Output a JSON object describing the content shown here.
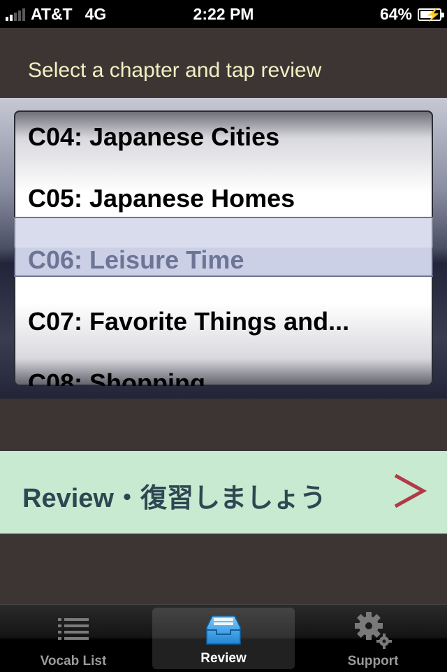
{
  "status_bar": {
    "carrier": "AT&T",
    "network": "4G",
    "time": "2:22 PM",
    "battery_percent": "64%",
    "battery_level": 0.64
  },
  "header": {
    "prompt": "Select a chapter and tap review"
  },
  "picker": {
    "items": [
      "C04: Japanese Cities",
      "C05: Japanese Homes",
      "C06: Leisure Time",
      "C07: Favorite Things and...",
      "C08: Shopping"
    ],
    "selected": "C06: Leisure Time"
  },
  "review_button": {
    "label": "Review・復習しましょう",
    "chevron_color": "#b23a48"
  },
  "tab_bar": {
    "tabs": [
      {
        "label": "Vocab List",
        "icon": "list-icon"
      },
      {
        "label": "Review",
        "icon": "inbox-tray-icon"
      },
      {
        "label": "Support",
        "icon": "gear-icon"
      }
    ],
    "active": "Review"
  },
  "colors": {
    "prompt_text": "#f3efc3",
    "review_bg": "#c7ead0",
    "review_text": "#2f4752",
    "background": "#3d3534"
  }
}
